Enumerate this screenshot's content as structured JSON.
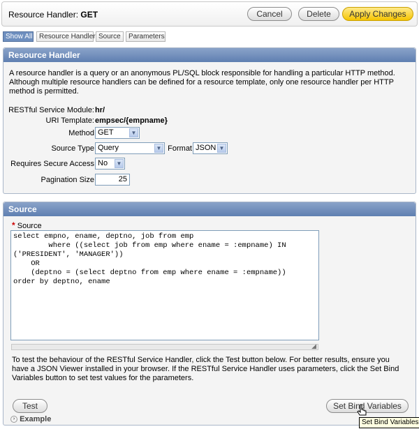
{
  "header": {
    "title_prefix": "Resource Handler: ",
    "title_value": "GET",
    "cancel_label": "Cancel",
    "delete_label": "Delete",
    "apply_label": "Apply Changes"
  },
  "tabs": [
    {
      "label": "Show All",
      "active": true
    },
    {
      "label": "Resource Handler",
      "active": false
    },
    {
      "label": "Source",
      "active": false
    },
    {
      "label": "Parameters",
      "active": false
    }
  ],
  "resource_handler": {
    "heading": "Resource Handler",
    "description": "A resource handler is a query or an anonymous PL/SQL block responsible for handling a particular HTTP method. Although multiple resource handlers can be defined for a resource template, only one resource handler per HTTP method is permitted.",
    "module_label": "RESTful Service Module:",
    "module_value": "hr/",
    "uri_label": "URI Template:",
    "uri_value": "empsec/{empname}",
    "method_label": "Method",
    "method_value": "GET",
    "source_type_label": "Source Type",
    "source_type_value": "Query",
    "format_label": "Format",
    "format_value": "JSON",
    "secure_label": "Requires Secure Access",
    "secure_value": "No",
    "pagination_label": "Pagination Size",
    "pagination_value": "25"
  },
  "source": {
    "heading": "Source",
    "required_mark": "*",
    "field_label": "Source",
    "code": "select empno, ename, deptno, job from emp\n        where ((select job from emp where ename = :empname) IN\n('PRESIDENT', 'MANAGER'))\n    OR\n    (deptno = (select deptno from emp where ename = :empname))\norder by deptno, ename",
    "help_text": "To test the behaviour of the RESTful Service Handler, click the Test button below. For better results, ensure you have a JSON Viewer installed in your browser. If the RESTful Service Handler uses parameters, click the Set Bind Variables button to set test values for the parameters.",
    "test_label": "Test",
    "bind_label": "Set Bind Variables",
    "example_label": "Example",
    "tooltip": "Set Bind Variables"
  }
}
